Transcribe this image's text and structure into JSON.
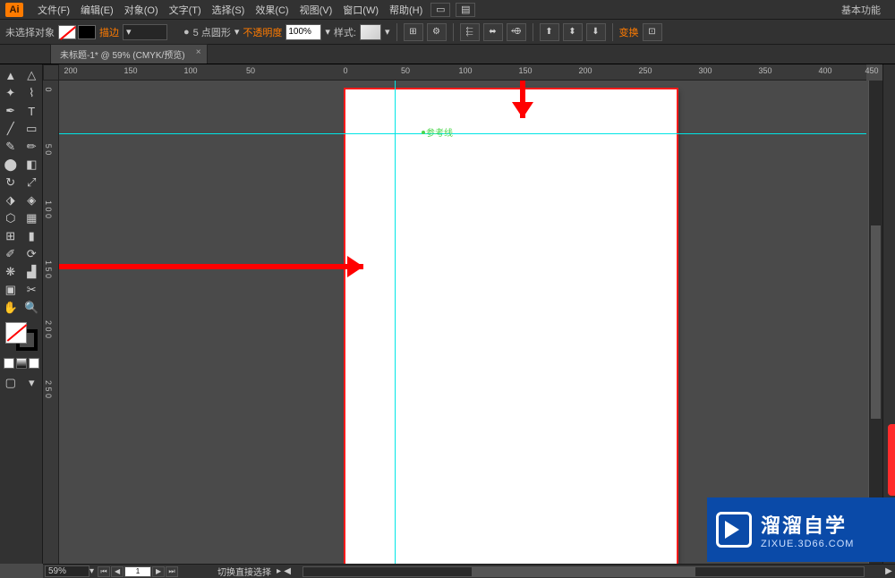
{
  "app": {
    "logo": "Ai"
  },
  "menu": {
    "items": [
      "文件(F)",
      "编辑(E)",
      "对象(O)",
      "文字(T)",
      "选择(S)",
      "效果(C)",
      "视图(V)",
      "窗口(W)",
      "帮助(H)"
    ],
    "workspace": "基本功能"
  },
  "optbar": {
    "selection": "未选择对象",
    "stroke_label": "描边",
    "stroke_weight_label": "5 点圆形",
    "opacity_label": "不透明度",
    "opacity_value": "100%",
    "style_label": "样式:",
    "transform_label": "变换"
  },
  "document": {
    "tab_title": "未标题-1* @ 59% (CMYK/预览)"
  },
  "ruler": {
    "h_ticks": [
      "200",
      "150",
      "100",
      "50",
      "0",
      "50",
      "100",
      "150",
      "200",
      "250",
      "300",
      "350",
      "400",
      "450"
    ],
    "v_ticks": [
      "0",
      "5 0",
      "1 0 0",
      "1 5 0",
      "2 0 0",
      "2 5 0"
    ]
  },
  "guide": {
    "label": "参考线"
  },
  "status": {
    "zoom": "59%",
    "page": "1",
    "info": "切换直接选择"
  },
  "watermark": {
    "title": "溜溜自学",
    "url": "ZIXUE.3D66.COM"
  }
}
